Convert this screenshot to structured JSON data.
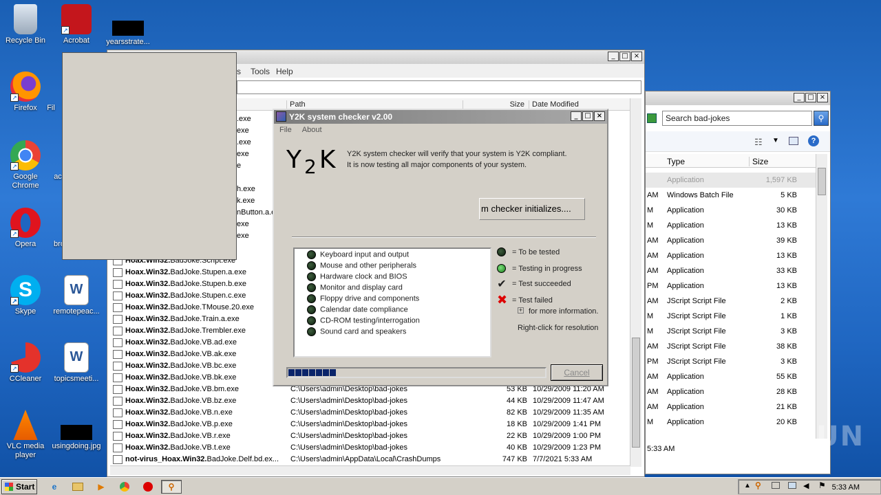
{
  "desktop": {
    "icons": [
      {
        "label": "Recycle Bin"
      },
      {
        "label": "Acrobat Reader DC"
      },
      {
        "label": "yearsstrate..."
      },
      {
        "label": "Firefox"
      },
      {
        "label": "Fil"
      },
      {
        "label": "Google Chrome"
      },
      {
        "label": "ac"
      },
      {
        "label": "Opera"
      },
      {
        "label": "bro"
      },
      {
        "label": "Skype"
      },
      {
        "label": "remotepeac..."
      },
      {
        "label": "CCleaner"
      },
      {
        "label": "topicsmeeti..."
      },
      {
        "label": "VLC media player"
      },
      {
        "label": "usingdoing.jpg"
      }
    ]
  },
  "explorer": {
    "menu": {
      "tools": "Tools",
      "help": "Help",
      "trunc": "s"
    },
    "columns": {
      "path": "Path",
      "size": "Size",
      "date": "Date Modified"
    },
    "partial_rows": [
      ".exe",
      "exe",
      ".exe",
      "exe",
      "e",
      "",
      "h.exe",
      "k.exe",
      "nButton.a.e",
      "exe",
      "exe"
    ],
    "rows": [
      {
        "prefix": "Hoax.Win32.",
        "name": "BadJoke.Script.exe",
        "path": "",
        "size": "",
        "date": ""
      },
      {
        "prefix": "Hoax.Win32.",
        "name": "BadJoke.Stupen.a.exe",
        "path": "",
        "size": "",
        "date": ""
      },
      {
        "prefix": "Hoax.Win32.",
        "name": "BadJoke.Stupen.b.exe",
        "path": "",
        "size": "",
        "date": ""
      },
      {
        "prefix": "Hoax.Win32.",
        "name": "BadJoke.Stupen.c.exe",
        "path": "",
        "size": "",
        "date": ""
      },
      {
        "prefix": "Hoax.Win32.",
        "name": "BadJoke.TMouse.20.exe",
        "path": "",
        "size": "",
        "date": ""
      },
      {
        "prefix": "Hoax.Win32.",
        "name": "BadJoke.Train.a.exe",
        "path": "",
        "size": "",
        "date": ""
      },
      {
        "prefix": "Hoax.Win32.",
        "name": "BadJoke.Trembler.exe",
        "path": "",
        "size": "",
        "date": ""
      },
      {
        "prefix": "Hoax.Win32.",
        "name": "BadJoke.VB.ad.exe",
        "path": "",
        "size": "",
        "date": ""
      },
      {
        "prefix": "Hoax.Win32.",
        "name": "BadJoke.VB.ak.exe",
        "path": "",
        "size": "",
        "date": ""
      },
      {
        "prefix": "Hoax.Win32.",
        "name": "BadJoke.VB.bc.exe",
        "path": "",
        "size": "",
        "date": ""
      },
      {
        "prefix": "Hoax.Win32.",
        "name": "BadJoke.VB.bk.exe",
        "path": "",
        "size": "",
        "date": ""
      },
      {
        "prefix": "Hoax.Win32.",
        "name": "BadJoke.VB.bm.exe",
        "path": "C:\\Users\\admin\\Desktop\\bad-jokes",
        "size": "53 KB",
        "date": "10/29/2009 11:20 AM"
      },
      {
        "prefix": "Hoax.Win32.",
        "name": "BadJoke.VB.bz.exe",
        "path": "C:\\Users\\admin\\Desktop\\bad-jokes",
        "size": "44 KB",
        "date": "10/29/2009 11:47 AM"
      },
      {
        "prefix": "Hoax.Win32.",
        "name": "BadJoke.VB.n.exe",
        "path": "C:\\Users\\admin\\Desktop\\bad-jokes",
        "size": "82 KB",
        "date": "10/29/2009 11:35 AM"
      },
      {
        "prefix": "Hoax.Win32.",
        "name": "BadJoke.VB.p.exe",
        "path": "C:\\Users\\admin\\Desktop\\bad-jokes",
        "size": "18 KB",
        "date": "10/29/2009 1:41 PM"
      },
      {
        "prefix": "Hoax.Win32.",
        "name": "BadJoke.VB.r.exe",
        "path": "C:\\Users\\admin\\Desktop\\bad-jokes",
        "size": "22 KB",
        "date": "10/29/2009 1:00 PM"
      },
      {
        "prefix": "Hoax.Win32.",
        "name": "BadJoke.VB.t.exe",
        "path": "C:\\Users\\admin\\Desktop\\bad-jokes",
        "size": "40 KB",
        "date": "10/29/2009 1:23 PM"
      },
      {
        "prefix": "not-virus_Hoax.Win32.",
        "name": "BadJoke.Delf.bd.ex...",
        "path": "C:\\Users\\admin\\AppData\\Local\\CrashDumps",
        "size": "747 KB",
        "date": "7/7/2021 5:33 AM"
      }
    ]
  },
  "rexplorer": {
    "search_placeholder": "Search bad-jokes",
    "columns": {
      "type": "Type",
      "size": "Size"
    },
    "rows": [
      {
        "tm": "",
        "type": "Application",
        "size": "1,597 KB"
      },
      {
        "tm": "AM",
        "type": "Windows Batch File",
        "size": "5 KB"
      },
      {
        "tm": "M",
        "type": "Application",
        "size": "30 KB"
      },
      {
        "tm": "M",
        "type": "Application",
        "size": "13 KB"
      },
      {
        "tm": "AM",
        "type": "Application",
        "size": "39 KB"
      },
      {
        "tm": "AM",
        "type": "Application",
        "size": "13 KB"
      },
      {
        "tm": "AM",
        "type": "Application",
        "size": "33 KB"
      },
      {
        "tm": "PM",
        "type": "Application",
        "size": "13 KB"
      },
      {
        "tm": "AM",
        "type": "JScript Script File",
        "size": "2 KB"
      },
      {
        "tm": "M",
        "type": "JScript Script File",
        "size": "1 KB"
      },
      {
        "tm": "M",
        "type": "JScript Script File",
        "size": "3 KB"
      },
      {
        "tm": "AM",
        "type": "JScript Script File",
        "size": "38 KB"
      },
      {
        "tm": "PM",
        "type": "JScript Script File",
        "size": "3 KB"
      },
      {
        "tm": "AM",
        "type": "Application",
        "size": "55 KB"
      },
      {
        "tm": "AM",
        "type": "Application",
        "size": "28 KB"
      },
      {
        "tm": "AM",
        "type": "Application",
        "size": "21 KB"
      },
      {
        "tm": "M",
        "type": "Application",
        "size": "20 KB"
      }
    ],
    "status_time": "5:33 AM"
  },
  "y2k": {
    "title": "Y2K system checker v2.00",
    "menu_file": "File",
    "menu_about": "About",
    "logo_y": "Y",
    "logo_2": "2",
    "logo_k": "K",
    "intro_line1": "Y2K system checker will verify that your system is Y2K compliant.",
    "intro_line2": "It is now testing all major components of your system.",
    "init_button": "m checker initializes....",
    "components": [
      {
        "label": "Keyboard input and output",
        "state": "pending"
      },
      {
        "label": "Mouse and other peripherals",
        "state": "pending"
      },
      {
        "label": "Hardware clock and BIOS",
        "state": "pending"
      },
      {
        "label": "Monitor and display card",
        "state": "pending"
      },
      {
        "label": "Floppy drive and components",
        "state": "pending"
      },
      {
        "label": "Calendar date compliance",
        "state": "pending"
      },
      {
        "label": "CD-ROM testing/interrogation",
        "state": "pending"
      },
      {
        "label": "Sound card and speakers",
        "state": "pending"
      }
    ],
    "legend": {
      "to_be_tested": "= To be tested",
      "in_progress": "= Testing in progress",
      "succeeded": "= Test succeeded",
      "failed": "= Test failed",
      "more_info": "for more information.",
      "right_click": "Right-click for resolution"
    },
    "progress": 0.2,
    "cancel": "Cancel"
  },
  "taskbar": {
    "start": "Start",
    "clock": "5:33 AM"
  },
  "watermark": "ANY RUN",
  "colors": {
    "desktop": "#1f66c1",
    "progress": "#0a246a",
    "y2k_title": "#8a8a8a"
  }
}
